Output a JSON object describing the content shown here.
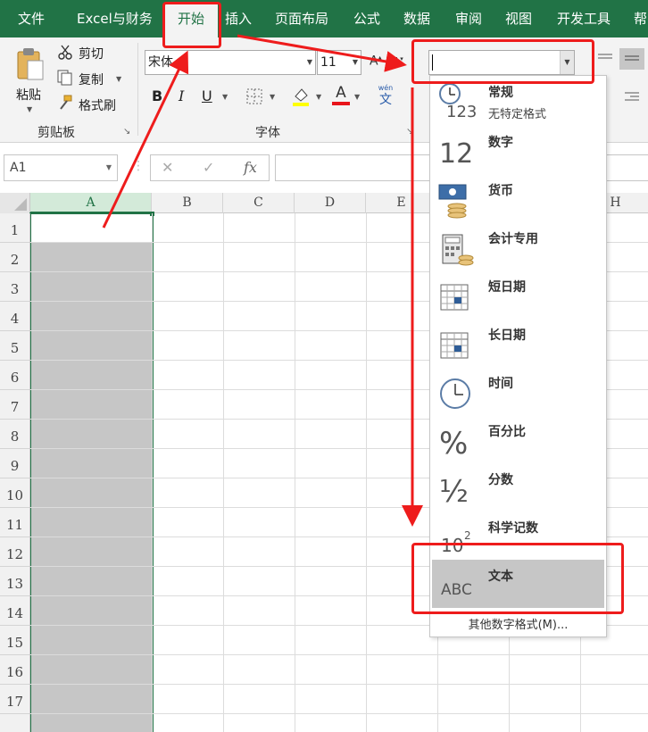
{
  "tabs": [
    {
      "label": "文件",
      "active": false
    },
    {
      "label": "Excel与财务",
      "active": false
    },
    {
      "label": "开始",
      "active": true
    },
    {
      "label": "插入",
      "active": false
    },
    {
      "label": "页面布局",
      "active": false
    },
    {
      "label": "公式",
      "active": false
    },
    {
      "label": "数据",
      "active": false
    },
    {
      "label": "审阅",
      "active": false
    },
    {
      "label": "视图",
      "active": false
    },
    {
      "label": "开发工具",
      "active": false
    },
    {
      "label": "帮",
      "active": false
    }
  ],
  "clipboard": {
    "paste": "粘贴",
    "cut": "剪切",
    "copy": "复制",
    "format_painter": "格式刷",
    "group_label": "剪贴板"
  },
  "font": {
    "name": "宋体",
    "size": "11",
    "bold": "B",
    "italic": "I",
    "underline": "U",
    "font_color_letter": "A",
    "phonetic_top": "wén",
    "phonetic_bottom": "文",
    "group_label": "字体"
  },
  "number_format": {
    "value": ""
  },
  "formula_bar": {
    "name_box": "A1",
    "cancel": "✕",
    "enter": "✓",
    "fx": "fx",
    "formula": ""
  },
  "sheet": {
    "columns": [
      "A",
      "B",
      "C",
      "D",
      "E",
      "H"
    ],
    "rows": [
      "1",
      "2",
      "3",
      "4",
      "5",
      "6",
      "7",
      "8",
      "9",
      "10",
      "11",
      "12",
      "13",
      "14",
      "15",
      "16",
      "17"
    ],
    "selected_column": "A",
    "active_cell": "A1"
  },
  "dropdown": {
    "items": [
      {
        "label": "常规",
        "sub": "无特定格式",
        "icon": "general-icon",
        "glyph": "123"
      },
      {
        "label": "数字",
        "sub": "",
        "icon": "number-icon",
        "glyph": "12"
      },
      {
        "label": "货币",
        "sub": "",
        "icon": "currency-icon",
        "glyph": ""
      },
      {
        "label": "会计专用",
        "sub": "",
        "icon": "accounting-icon",
        "glyph": ""
      },
      {
        "label": "短日期",
        "sub": "",
        "icon": "short-date-icon",
        "glyph": ""
      },
      {
        "label": "长日期",
        "sub": "",
        "icon": "long-date-icon",
        "glyph": ""
      },
      {
        "label": "时间",
        "sub": "",
        "icon": "time-icon",
        "glyph": ""
      },
      {
        "label": "百分比",
        "sub": "",
        "icon": "percent-icon",
        "glyph": "%"
      },
      {
        "label": "分数",
        "sub": "",
        "icon": "fraction-icon",
        "glyph": "½"
      },
      {
        "label": "科学记数",
        "sub": "",
        "icon": "scientific-icon",
        "glyph": "10"
      },
      {
        "label": "文本",
        "sub": "",
        "icon": "text-format-icon",
        "glyph": "ABC"
      }
    ],
    "more_formats": "其他数字格式(M)...",
    "highlighted": "文本"
  },
  "colors": {
    "accent": "#217346",
    "annotation": "#ee1c1c",
    "selection": "#c6c6c6"
  }
}
